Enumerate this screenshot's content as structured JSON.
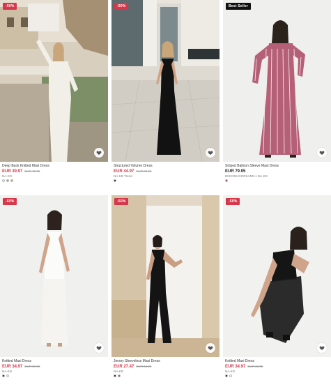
{
  "products": [
    {
      "badge": "-50%",
      "name": "Deep Back Knitted Maxi Dress",
      "price": "EUR 39.97",
      "old_price": "EUR 79.95",
      "sub": "NA-KD",
      "swatches": [
        "#f3f1ec",
        "#8f9a98",
        "#d7a24e"
      ]
    },
    {
      "badge": "-50%",
      "name": "Structured Volume Dress",
      "price": "EUR 44.97",
      "old_price": "EUR 89.95",
      "sub": "NA-KD Trend",
      "swatches": [
        "#111111"
      ]
    },
    {
      "badge": "Best Seller",
      "name": "Striped Balloon Sleeve Maxi Dress",
      "price": "EUR 79.95",
      "old_price": "",
      "sub": "DISCOSAVORKANN x NA-KD",
      "swatches": [
        "#b0435a"
      ]
    },
    {
      "badge": "-60%",
      "name": "Knitted Maxi Dress",
      "price": "EUR 34.97",
      "old_price": "EUR 69.95",
      "sub": "NA-KD",
      "swatches": [
        "#111111",
        "#f3f1ec"
      ]
    },
    {
      "badge": "-50%",
      "name": "Jersey Sleeveless Maxi Dress",
      "price": "EUR 27.47",
      "old_price": "EUR 54.95",
      "sub": "NA-KD",
      "swatches": [
        "#111111",
        "#c0433f"
      ]
    },
    {
      "badge": "-50%",
      "name": "Knitted Maxi Dress",
      "price": "EUR 34.97",
      "old_price": "EUR 69.95",
      "sub": "NA-KD",
      "swatches": [
        "#111111",
        "#f3f1ec"
      ]
    }
  ],
  "colors": {
    "sale_red": "#d6374a",
    "best_seller_bg": "#111111"
  },
  "icons": {
    "wishlist": "heart-icon"
  }
}
